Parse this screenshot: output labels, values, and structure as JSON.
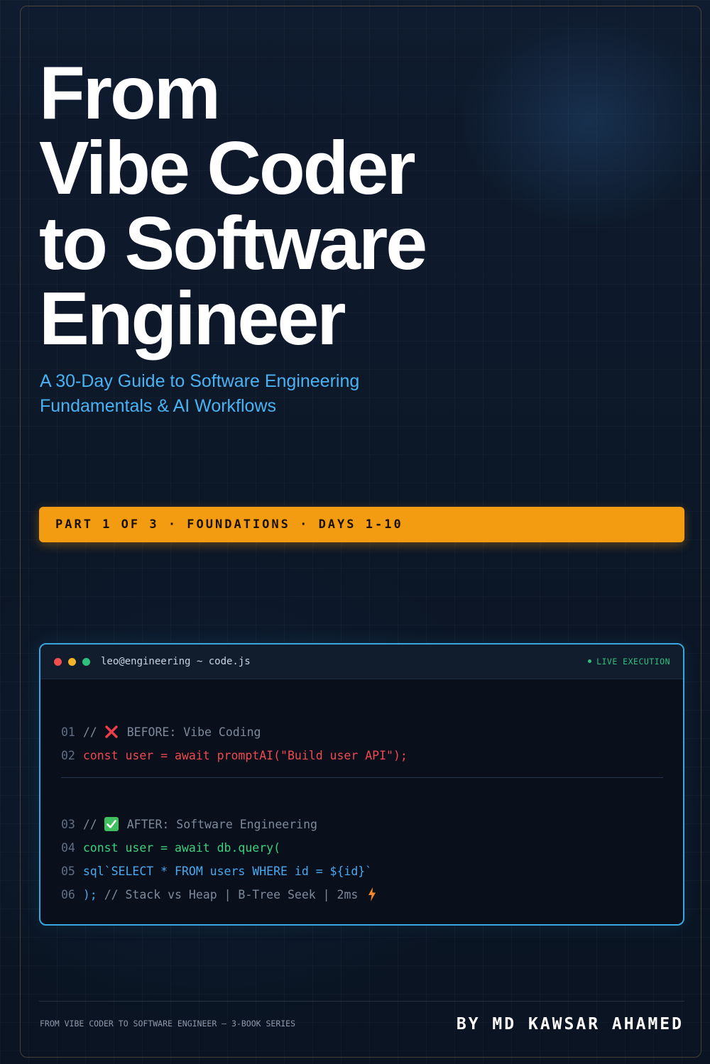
{
  "cover": {
    "title_lines": [
      "From",
      "Vibe Coder",
      "to Software",
      "Engineer"
    ],
    "subtitle_lines": [
      "A 30-Day Guide to Software Engineering",
      "Fundamentals & AI Workflows"
    ],
    "banner": "PART 1 OF 3 · FOUNDATIONS · DAYS 1-10"
  },
  "terminal": {
    "title": "leo@engineering ~ code.js",
    "status": "LIVE EXECUTION",
    "lines": [
      {
        "num": "01",
        "prefix": "//",
        "icon": "cross-mark-icon",
        "text": "BEFORE: Vibe Coding"
      },
      {
        "num": "02",
        "text": "const user = await promptAI(\"Build user API\");"
      },
      {
        "num": "03",
        "prefix": "//",
        "icon": "check-mark-icon",
        "text": "AFTER: Software Engineering"
      },
      {
        "num": "04",
        "text": "const user = await db.query("
      },
      {
        "num": "05",
        "text": "sql`SELECT * FROM users WHERE id = ${id}`"
      },
      {
        "num": "06",
        "code": ");",
        "comment": "// Stack vs Heap | B-Tree Seek | 2ms",
        "icon": "lightning-bolt-icon"
      }
    ]
  },
  "footer": {
    "series": "FROM VIBE CODER TO SOFTWARE ENGINEER — 3-BOOK SERIES",
    "author": "BY MD KAWSAR AHAMED"
  },
  "colors": {
    "background": "#0c1727",
    "title": "#ffffff",
    "subtitle": "#4ab2f2",
    "banner": "#f39c12",
    "terminal_border": "#3aa8e0",
    "code_before": "#f0494f",
    "code_after": "#3ecf7e",
    "code_sql": "#4aa8ee",
    "live_status": "#2ec27e"
  }
}
